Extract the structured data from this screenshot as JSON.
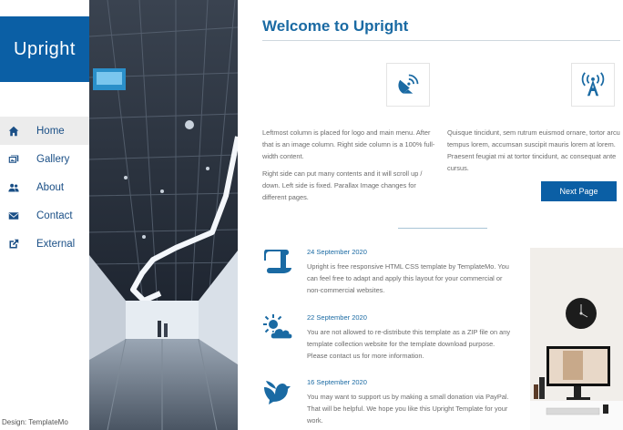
{
  "sidebar": {
    "logo": "Upright",
    "items": [
      {
        "label": "Home",
        "icon": "home-icon"
      },
      {
        "label": "Gallery",
        "icon": "gallery-icon"
      },
      {
        "label": "About",
        "icon": "users-icon"
      },
      {
        "label": "Contact",
        "icon": "envelope-icon"
      },
      {
        "label": "External",
        "icon": "external-link-icon"
      }
    ],
    "credit": "Design: TemplateMo"
  },
  "main": {
    "title": "Welcome to Upright",
    "left_col": {
      "icon": "satellite-dish-icon",
      "p1": "Leftmost column is placed for logo and main menu. After that is an image column. Right side column is a 100% full-width content.",
      "p2": "Right side can put many contents and it will scroll up / down. Left side is fixed. Parallax Image changes for different pages."
    },
    "right_col": {
      "icon": "broadcast-tower-icon",
      "p1": "Quisque tincidunt, sem rutrum euismod ornare, tortor arcu tempus lorem, accumsan suscipit mauris lorem at lorem. Praesent feugiat mi at tortor tincidunt, ac consequat ante cursus.",
      "button": "Next Page"
    },
    "news": [
      {
        "icon": "scroll-icon",
        "date": "24 September 2020",
        "text": "Upright is free responsive HTML CSS template by TemplateMo. You can feel free to adapt and apply this layout for your commercial or non-commercial websites."
      },
      {
        "icon": "cloud-sun-icon",
        "date": "22 September 2020",
        "text": "You are not allowed to re-distribute this template as a ZIP file on any template collection website for the template download purpose. Please contact us for more information."
      },
      {
        "icon": "dove-icon",
        "date": "16 September 2020",
        "text": "You may want to support us by making a small donation via PayPal. That will be helpful. We hope you like this Upright Template for your work."
      }
    ]
  },
  "colors": {
    "brand": "#0b5fa5",
    "heading": "#1a6aa3",
    "nav_active_bg": "#ececec"
  }
}
